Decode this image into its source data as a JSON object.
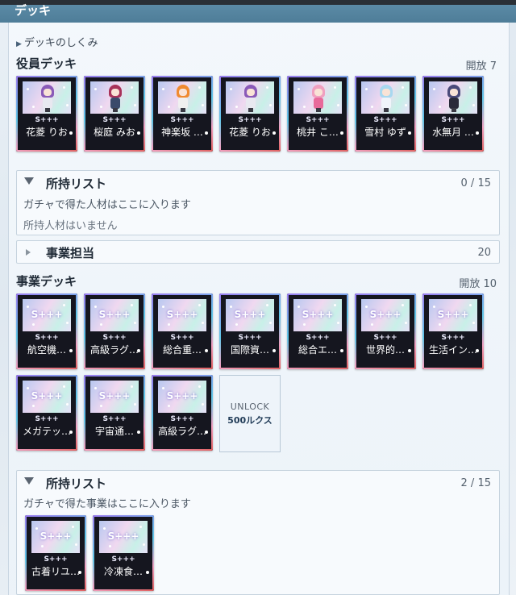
{
  "header": {
    "title": "デッキ"
  },
  "howto": {
    "label": "デッキのしくみ"
  },
  "officer_deck": {
    "title": "役員デッキ",
    "open": "開放 7",
    "cards": [
      {
        "rank": "S+++",
        "name": "花菱 りお",
        "hair": "#8a5ab8",
        "outfit": "#e8e8f0"
      },
      {
        "rank": "S+++",
        "name": "桜庭 みお",
        "hair": "#a8325a",
        "outfit": "#3a4a6a"
      },
      {
        "rank": "S+++",
        "name": "神楽坂 …",
        "hair": "#f08a30",
        "outfit": "#f0f0f0"
      },
      {
        "rank": "S+++",
        "name": "花菱 りお",
        "hair": "#8a5ab8",
        "outfit": "#e8e8f0"
      },
      {
        "rank": "S+++",
        "name": "桃井 こ…",
        "hair": "#f0a0c0",
        "outfit": "#e86a9a"
      },
      {
        "rank": "S+++",
        "name": "雪村 ゆず",
        "hair": "#a8d8f0",
        "outfit": "#f0f4fa"
      },
      {
        "rank": "S+++",
        "name": "水無月 …",
        "hair": "#4a4a7a",
        "outfit": "#2a2a3a"
      }
    ]
  },
  "owned_talent": {
    "title": "所持リスト",
    "count": "0 / 15",
    "desc": "ガチャで得た人材はここに入ります",
    "empty": "所持人材はいません"
  },
  "business_manager": {
    "title": "事業担当",
    "count": "20"
  },
  "business_deck": {
    "title": "事業デッキ",
    "open": "開放 10",
    "cards": [
      {
        "rank": "S+++",
        "art": "S+++",
        "name": "航空機…"
      },
      {
        "rank": "S+++",
        "art": "S+++",
        "name": "高級ラグ…"
      },
      {
        "rank": "S+++",
        "art": "S+++",
        "name": "総合重…"
      },
      {
        "rank": "S+++",
        "art": "S+++",
        "name": "国際資…"
      },
      {
        "rank": "S+++",
        "art": "S+++",
        "name": "総合エ…"
      },
      {
        "rank": "S+++",
        "art": "S+++",
        "name": "世界的…"
      },
      {
        "rank": "S+++",
        "art": "S+++",
        "name": "生活イン…"
      },
      {
        "rank": "S+++",
        "art": "S+++",
        "name": "メガテッ…"
      },
      {
        "rank": "S+++",
        "art": "S+++",
        "name": "宇宙通…"
      },
      {
        "rank": "S+++",
        "art": "S+++",
        "name": "高級ラグ…"
      }
    ],
    "unlock": {
      "label": "UNLOCK",
      "cost": "500ルクス"
    }
  },
  "owned_business": {
    "title": "所持リスト",
    "count": "2 / 15",
    "desc": "ガチャで得た事業はここに入ります",
    "cards": [
      {
        "rank": "S+++",
        "art": "S+++",
        "name": "古着リユ…"
      },
      {
        "rank": "S+++",
        "art": "S+++",
        "name": "冷凍食…"
      }
    ]
  }
}
